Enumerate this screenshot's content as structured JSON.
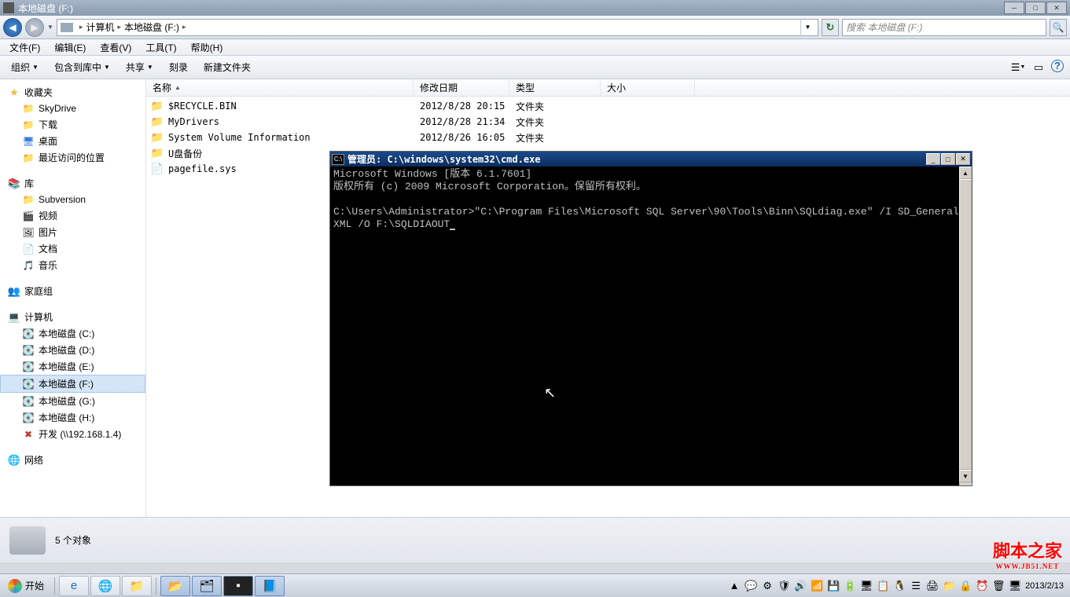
{
  "window": {
    "title": "本地磁盘 (F:)",
    "btn_min": "─",
    "btn_max": "□",
    "btn_close": "✕"
  },
  "nav": {
    "back": "◀",
    "fwd": "▶",
    "crumb1": "计算机",
    "crumb2": "本地磁盘 (F:)",
    "search_placeholder": "搜索 本地磁盘 (F:)",
    "search_icon": "🔍",
    "refresh": "↻"
  },
  "menu": {
    "file": "文件(F)",
    "edit": "编辑(E)",
    "view": "查看(V)",
    "tools": "工具(T)",
    "help": "帮助(H)"
  },
  "toolbar": {
    "organize": "组织",
    "include": "包含到库中",
    "share": "共享",
    "burn": "刻录",
    "newfolder": "新建文件夹",
    "view_icon": "☰",
    "pane_icon": "▭",
    "help_icon": "?"
  },
  "columns": {
    "name": "名称",
    "date": "修改日期",
    "type": "类型",
    "size": "大小"
  },
  "sidebar": {
    "favorites": "收藏夹",
    "fav_items": [
      "SkyDrive",
      "下载",
      "桌面",
      "最近访问的位置"
    ],
    "library": "库",
    "lib_items": [
      "Subversion",
      "视频",
      "图片",
      "文档",
      "音乐"
    ],
    "homegroup": "家庭组",
    "computer": "计算机",
    "drives": [
      "本地磁盘 (C:)",
      "本地磁盘 (D:)",
      "本地磁盘 (E:)",
      "本地磁盘 (F:)",
      "本地磁盘 (G:)",
      "本地磁盘 (H:)",
      "开发 (\\\\192.168.1.4)"
    ],
    "network": "网络"
  },
  "files": [
    {
      "name": "$RECYCLE.BIN",
      "date": "2012/8/28 20:15",
      "type": "文件夹",
      "icon": "📁"
    },
    {
      "name": "MyDrivers",
      "date": "2012/8/28 21:34",
      "type": "文件夹",
      "icon": "📁"
    },
    {
      "name": "System Volume Information",
      "date": "2012/8/26 16:05",
      "type": "文件夹",
      "icon": "📁"
    },
    {
      "name": "U盘备份",
      "date": "",
      "type": "",
      "icon": "📁"
    },
    {
      "name": "pagefile.sys",
      "date": "",
      "type": "",
      "icon": "📄"
    }
  ],
  "cmd": {
    "title": "管理员: C:\\windows\\system32\\cmd.exe",
    "line1": "Microsoft Windows [版本 6.1.7601]",
    "line2": "版权所有 (c) 2009 Microsoft Corporation。保留所有权利。",
    "line3": "C:\\Users\\Administrator>\"C:\\Program Files\\Microsoft SQL Server\\90\\Tools\\Binn\\SQLdiag.exe\" /I SD_General.XML /O F:\\SQLDIAOUT",
    "btn_min": "_",
    "btn_max": "□",
    "btn_close": "✕"
  },
  "status": {
    "text": "5 个对象"
  },
  "taskbar": {
    "start": "开始",
    "date": "2013/2/13"
  },
  "watermark": {
    "main": "脚本之家",
    "sub": "WWW.JB51.NET"
  }
}
